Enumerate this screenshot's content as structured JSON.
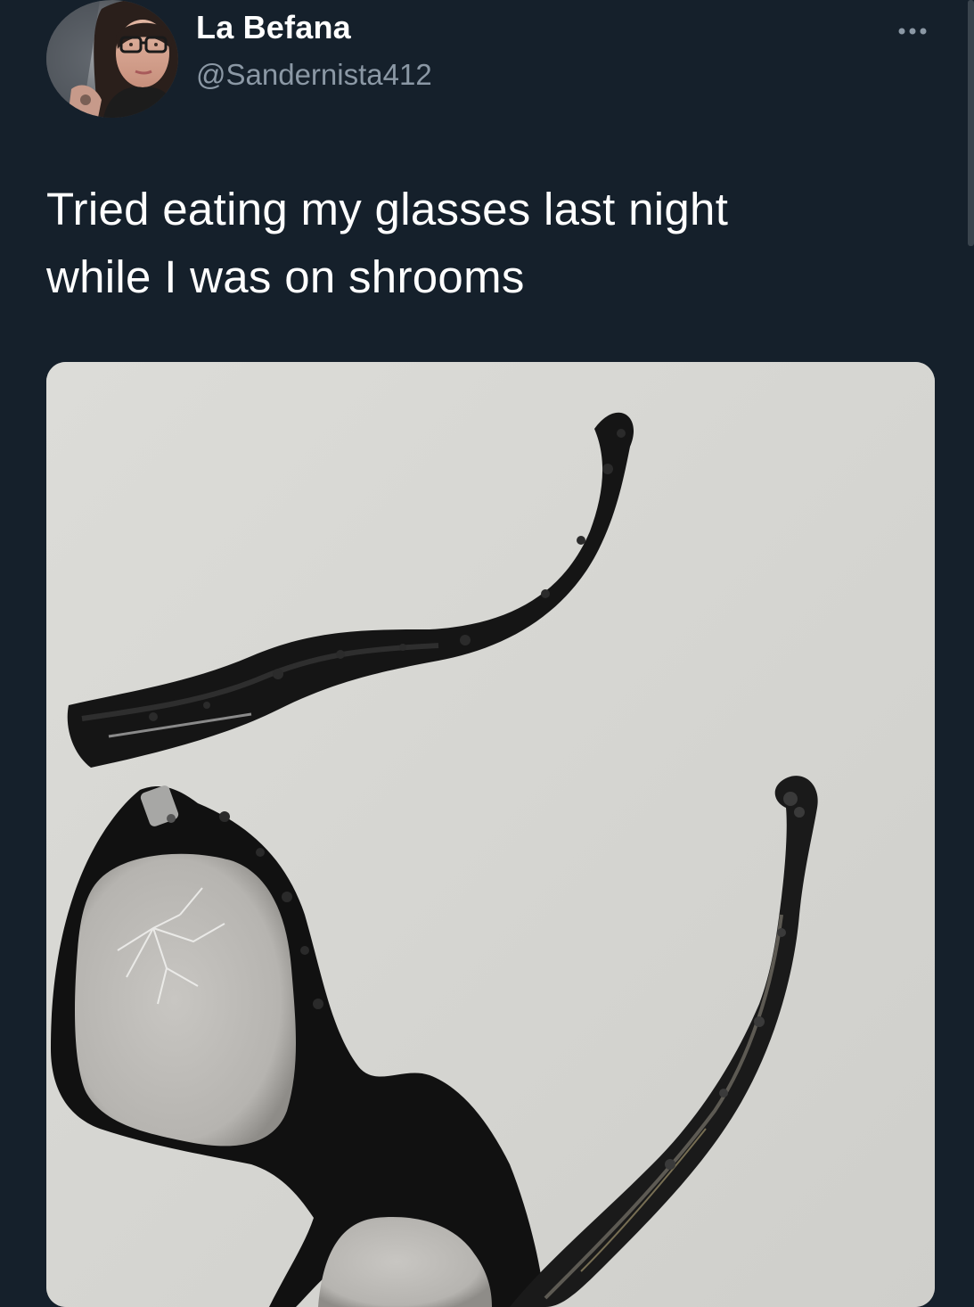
{
  "tweet": {
    "author": {
      "display_name": "La Befana",
      "handle": "@Sandernista412",
      "avatar_icon": "user-avatar-photo"
    },
    "more_icon": "more-dots-icon",
    "text_line_1": "Tried eating my glasses last night",
    "text_line_2": "while I was on shrooms",
    "media": {
      "type": "photo",
      "icon": "burnt-glasses-photo"
    }
  },
  "theme": {
    "background": "#15202b",
    "text_primary": "#ffffff",
    "text_secondary": "#8b98a5"
  }
}
